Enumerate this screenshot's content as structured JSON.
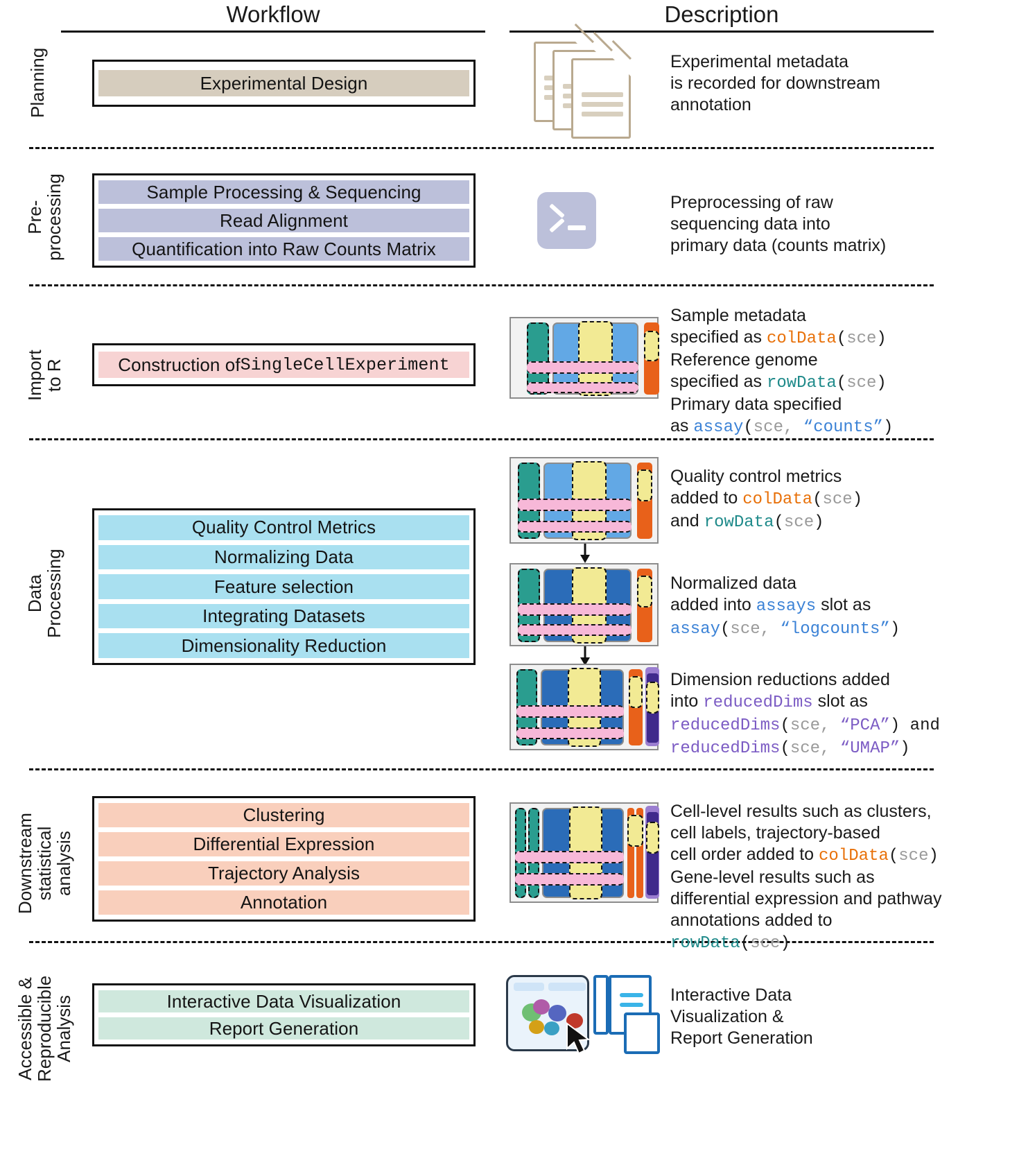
{
  "headers": {
    "workflow": "Workflow",
    "description": "Description"
  },
  "colors": {
    "planning": "#d6cdbe",
    "preprocessing": "#bcc0da",
    "import": "#f7d3d3",
    "data_processing": "#a9e0f0",
    "downstream": "#f9cfbc",
    "accessible": "#cfe8dd",
    "colData": "#e8710a",
    "rowData": "#1f8a8a",
    "assay": "#3b82d6",
    "reducedDims": "#7c5cc4",
    "sce_arg": "#9a9a9a"
  },
  "sections": [
    {
      "id": "planning",
      "label": "Planning",
      "steps": [
        "Experimental Design"
      ],
      "icon": "documents-stack-icon",
      "description_lines": [
        "Experimental metadata",
        "is recorded for downstream",
        "annotation"
      ]
    },
    {
      "id": "preprocessing",
      "label": "Pre-\nprocessing",
      "label_line1": "Pre-",
      "label_line2": "processing",
      "steps": [
        "Sample Processing & Sequencing",
        "Read Alignment",
        "Quantification into Raw Counts Matrix"
      ],
      "icon": "terminal-icon",
      "description_lines": [
        "Preprocessing of raw",
        "sequencing data into",
        "primary data (counts matrix)"
      ]
    },
    {
      "id": "import",
      "label_line1": "Import",
      "label_line2": "to R",
      "steps_rich": [
        {
          "plain": "Construction of ",
          "code": "SingleCellExperiment"
        }
      ],
      "icon": "sce-schematic-icon",
      "description_rich": [
        [
          {
            "t": "Sample metadata",
            "c": "plain"
          }
        ],
        [
          {
            "t": "specified as ",
            "c": "plain"
          },
          {
            "t": "colData",
            "c": "orange-code"
          },
          {
            "t": "(",
            "c": "plain"
          },
          {
            "t": "sce",
            "c": "gray-code"
          },
          {
            "t": ")",
            "c": "plain"
          }
        ],
        [
          {
            "t": "Reference genome",
            "c": "plain"
          }
        ],
        [
          {
            "t": "specified as ",
            "c": "plain"
          },
          {
            "t": "rowData",
            "c": "teal-code"
          },
          {
            "t": "(",
            "c": "plain"
          },
          {
            "t": "sce",
            "c": "gray-code"
          },
          {
            "t": ")",
            "c": "plain"
          }
        ],
        [
          {
            "t": "Primary data specified",
            "c": "plain"
          }
        ],
        [
          {
            "t": "as ",
            "c": "plain"
          },
          {
            "t": "assay",
            "c": "blue-code"
          },
          {
            "t": "(",
            "c": "plain"
          },
          {
            "t": "sce, ",
            "c": "gray-code"
          },
          {
            "t": "“counts”",
            "c": "blue-code"
          },
          {
            "t": ")",
            "c": "plain"
          }
        ]
      ]
    },
    {
      "id": "data_processing",
      "label_line1": "Data",
      "label_line2": "Processing",
      "steps": [
        "Quality Control Metrics",
        "Normalizing Data",
        "Feature selection",
        "Integrating Datasets",
        "Dimensionality Reduction"
      ],
      "panels": [
        {
          "icon": "sce-schematic-qc-icon",
          "description_rich": [
            [
              {
                "t": "Quality control metrics",
                "c": "plain"
              }
            ],
            [
              {
                "t": "added to ",
                "c": "plain"
              },
              {
                "t": "colData",
                "c": "orange-code"
              },
              {
                "t": "(",
                "c": "plain"
              },
              {
                "t": "sce",
                "c": "gray-code"
              },
              {
                "t": ")",
                "c": "plain"
              }
            ],
            [
              {
                "t": "and ",
                "c": "plain"
              },
              {
                "t": "rowData",
                "c": "teal-code"
              },
              {
                "t": "(",
                "c": "plain"
              },
              {
                "t": "sce",
                "c": "gray-code"
              },
              {
                "t": ")",
                "c": "plain"
              }
            ]
          ]
        },
        {
          "icon": "sce-schematic-norm-icon",
          "description_rich": [
            [
              {
                "t": "Normalized data",
                "c": "plain"
              }
            ],
            [
              {
                "t": "added into ",
                "c": "plain"
              },
              {
                "t": "assays",
                "c": "blue-code"
              },
              {
                "t": " slot as",
                "c": "plain"
              }
            ],
            [
              {
                "t": "assay",
                "c": "blue-code"
              },
              {
                "t": "(",
                "c": "plain"
              },
              {
                "t": "sce, ",
                "c": "gray-code"
              },
              {
                "t": "“logcounts”",
                "c": "blue-code"
              },
              {
                "t": ")",
                "c": "plain"
              }
            ]
          ]
        },
        {
          "icon": "sce-schematic-dimred-icon",
          "description_rich": [
            [
              {
                "t": "Dimension reductions added",
                "c": "plain"
              }
            ],
            [
              {
                "t": "into ",
                "c": "plain"
              },
              {
                "t": "reducedDims",
                "c": "purple-code"
              },
              {
                "t": " slot as",
                "c": "plain"
              }
            ],
            [
              {
                "t": "reducedDims",
                "c": "purple-code"
              },
              {
                "t": "(",
                "c": "plain"
              },
              {
                "t": "sce, ",
                "c": "gray-code"
              },
              {
                "t": "“PCA”",
                "c": "purple-code"
              },
              {
                "t": ") and",
                "c": "plain"
              }
            ],
            [
              {
                "t": "reducedDims",
                "c": "purple-code"
              },
              {
                "t": "(",
                "c": "plain"
              },
              {
                "t": "sce, ",
                "c": "gray-code"
              },
              {
                "t": "“UMAP”",
                "c": "purple-code"
              },
              {
                "t": ")",
                "c": "plain"
              }
            ]
          ]
        }
      ]
    },
    {
      "id": "downstream",
      "label_line1": "Downstream",
      "label_line2": "statistical",
      "label_line3": "analysis",
      "steps": [
        "Clustering",
        "Differential Expression",
        "Trajectory Analysis",
        "Annotation"
      ],
      "icon": "sce-schematic-results-icon",
      "description_rich": [
        [
          {
            "t": "Cell-level results such as  clusters,",
            "c": "plain"
          }
        ],
        [
          {
            "t": "cell labels, trajectory-based",
            "c": "plain"
          }
        ],
        [
          {
            "t": "cell order added to ",
            "c": "plain"
          },
          {
            "t": "colData",
            "c": "orange-code"
          },
          {
            "t": "(",
            "c": "plain"
          },
          {
            "t": "sce",
            "c": "gray-code"
          },
          {
            "t": ")",
            "c": "plain"
          }
        ],
        [
          {
            "t": "Gene-level results such as",
            "c": "plain"
          }
        ],
        [
          {
            "t": "differential expression and pathway",
            "c": "plain"
          }
        ],
        [
          {
            "t": "annotations added to ",
            "c": "plain"
          },
          {
            "t": "rowData",
            "c": "teal-code"
          },
          {
            "t": "(",
            "c": "plain"
          },
          {
            "t": "sce",
            "c": "gray-code"
          },
          {
            "t": ")",
            "c": "plain"
          }
        ]
      ]
    },
    {
      "id": "accessible",
      "label_line1": "Accessible &",
      "label_line2": "Reproducible",
      "label_line3": "Analysis",
      "steps": [
        "Interactive Data Visualization",
        "Report Generation"
      ],
      "icon": "interactive-viz-report-icon",
      "description_lines": [
        "Interactive Data",
        "Visualization &",
        "Report Generation"
      ]
    }
  ]
}
